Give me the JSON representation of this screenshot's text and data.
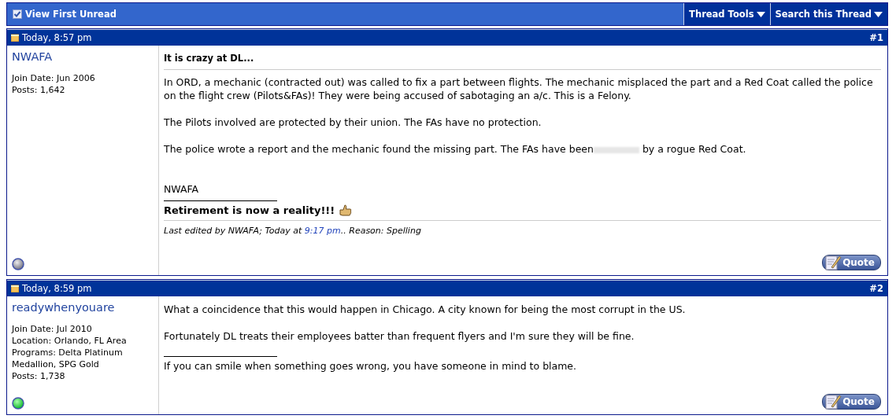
{
  "toolbar": {
    "view_first_unread": "View First Unread",
    "menus": [
      "Thread Tools",
      "Search this Thread"
    ]
  },
  "posts": [
    {
      "date": "Today, 8:57 pm",
      "number": "#1",
      "username": "NWAFA",
      "info": [
        "Join Date: Jun 2006",
        "Posts: 1,642"
      ],
      "online": false,
      "title": "It is crazy at DL...",
      "paragraphs": [
        {
          "text": "In ORD, a mechanic (contracted out) was called to fix a part between flights. The mechanic misplaced the part and a Red Coat called the police on the flight crew (Pilots&FAs)! They were being accused of sabotaging an a/c. This is a Felony."
        },
        {
          "text": "The Pilots involved are protected by their union. The FAs have no protection."
        },
        {
          "text": "The police wrote a report and the mechanic found the missing part. The FAs have been",
          "text_after": "by a rogue Red Coat."
        }
      ],
      "signoff": "NWAFA",
      "signature": "Retirement is now a reality!!!",
      "signature_bold": true,
      "signature_icon": true,
      "edit_note": {
        "before": "Last edited by NWAFA; Today at ",
        "link": "9:17 pm",
        "after": ".. Reason: Spelling"
      },
      "quote": "Quote"
    },
    {
      "date": "Today, 8:59 pm",
      "number": "#2",
      "username": "readywhenyouare",
      "info": [
        "Join Date: Jul 2010",
        "Location: Orlando, FL Area",
        "Programs: Delta Platinum Medallion, SPG Gold",
        "Posts: 1,738"
      ],
      "online": true,
      "paragraphs": [
        {
          "text": "What a coincidence that this would happen in Chicago. A city known for being the most corrupt in the US."
        },
        {
          "text": "Fortunately DL treats their employees batter than frequent flyers and I'm sure they will be fine."
        }
      ],
      "signature": "If you can smile when something goes wrong, you have someone in mind to blame.",
      "signature_bold": false,
      "signature_icon": false,
      "quote": "Quote"
    }
  ]
}
